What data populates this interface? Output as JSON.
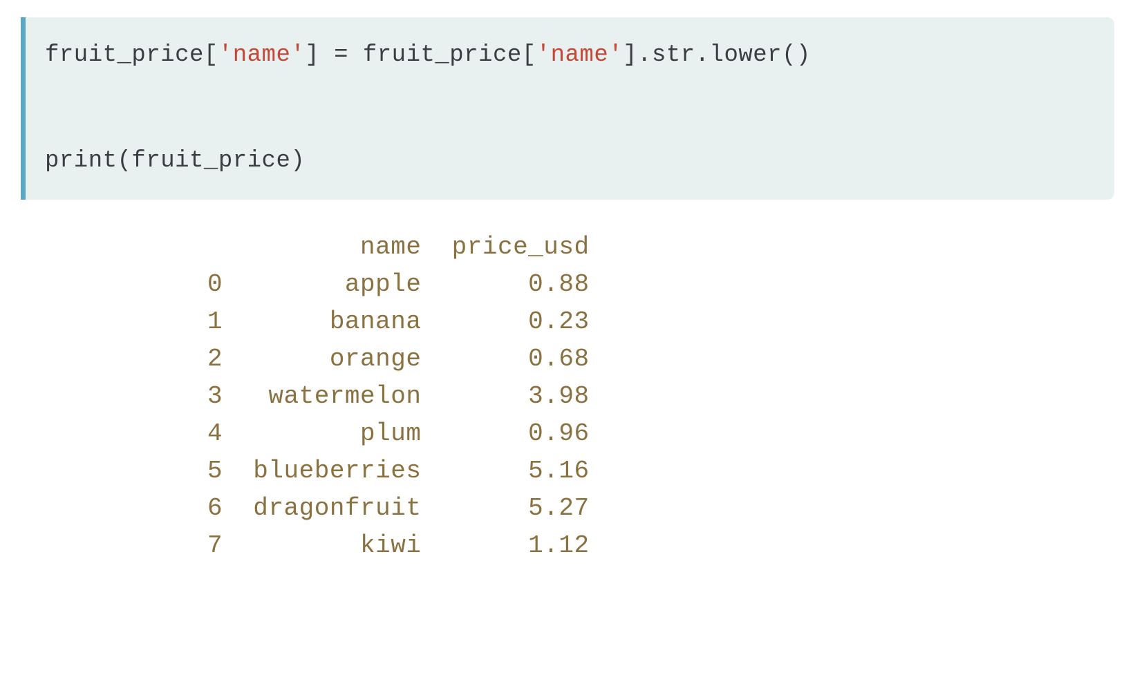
{
  "code": {
    "line1_part1": "fruit_price[",
    "line1_str1": "'name'",
    "line1_part2": "] = fruit_price[",
    "line1_str2": "'name'",
    "line1_part3": "].str.lower()",
    "line2": "",
    "line3": "print(fruit_price)"
  },
  "output": {
    "header": "          name  price_usd",
    "rows": [
      "0        apple       0.88",
      "1       banana       0.23",
      "2       orange       0.68",
      "3   watermelon       3.98",
      "4         plum       0.96",
      "5  blueberries       5.16",
      "6  dragonfruit       5.27",
      "7         kiwi       1.12"
    ]
  },
  "chart_data": {
    "type": "table",
    "columns": [
      "index",
      "name",
      "price_usd"
    ],
    "rows": [
      {
        "index": 0,
        "name": "apple",
        "price_usd": 0.88
      },
      {
        "index": 1,
        "name": "banana",
        "price_usd": 0.23
      },
      {
        "index": 2,
        "name": "orange",
        "price_usd": 0.68
      },
      {
        "index": 3,
        "name": "watermelon",
        "price_usd": 3.98
      },
      {
        "index": 4,
        "name": "plum",
        "price_usd": 0.96
      },
      {
        "index": 5,
        "name": "blueberries",
        "price_usd": 5.16
      },
      {
        "index": 6,
        "name": "dragonfruit",
        "price_usd": 5.27
      },
      {
        "index": 7,
        "name": "kiwi",
        "price_usd": 1.12
      }
    ]
  }
}
